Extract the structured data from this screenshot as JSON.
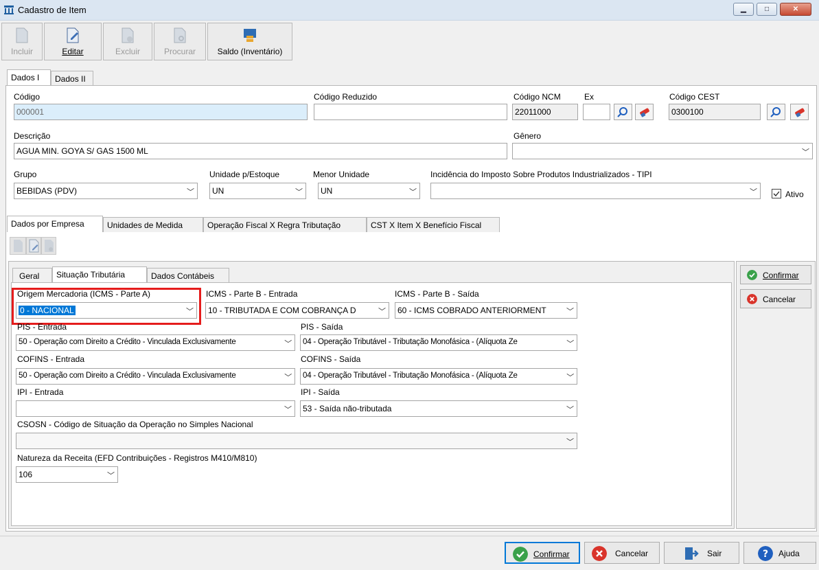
{
  "window": {
    "title": "Cadastro de Item"
  },
  "toolbar": {
    "incluir": "Incluir",
    "editar": "Editar",
    "excluir": "Excluir",
    "procurar": "Procurar",
    "saldo": "Saldo (Inventário)"
  },
  "top_tabs": [
    "Dados I",
    "Dados II"
  ],
  "dados1": {
    "codigo_label": "Código",
    "codigo_value": "000001",
    "codigo_reduzido_label": "Código Reduzido",
    "codigo_reduzido_value": "",
    "ncm_label": "Código NCM",
    "ncm_value": "22011000",
    "ex_label": "Ex",
    "ex_value": "",
    "cest_label": "Código CEST",
    "cest_value": "0300100",
    "descricao_label": "Descrição",
    "descricao_value": "AGUA MIN. GOYA S/ GAS 1500 ML",
    "genero_label": "Gênero",
    "genero_value": "",
    "grupo_label": "Grupo",
    "grupo_value": "BEBIDAS (PDV)",
    "unidade_label": "Unidade p/Estoque",
    "unidade_value": "UN",
    "menor_unidade_label": "Menor Unidade",
    "menor_unidade_value": "UN",
    "tipi_label": "Incidência do Imposto Sobre Produtos Industrializados - TIPI",
    "tipi_value": "",
    "ativo_label": "Ativo",
    "ativo_checked": true
  },
  "mid_tabs": [
    "Dados por Empresa",
    "Unidades de Medida",
    "Operação Fiscal X Regra Tributação",
    "CST X Item X Benefício Fiscal"
  ],
  "inner_tabs": [
    "Geral",
    "Situação Tributária",
    "Dados Contábeis"
  ],
  "tributaria": {
    "origem_label": "Origem Mercadoria (ICMS - Parte A)",
    "origem_value": "0 - NACIONAL",
    "icms_b_entrada_label": "ICMS - Parte B - Entrada",
    "icms_b_entrada_value": "10 - TRIBUTADA E COM COBRANÇA D",
    "icms_b_saida_label": "ICMS - Parte B - Saída",
    "icms_b_saida_value": "60 - ICMS COBRADO ANTERIORMENT",
    "pis_entrada_label": "PIS - Entrada",
    "pis_entrada_value": "50 - Operação com Direito a Crédito - Vinculada Exclusivamente",
    "pis_saida_label": "PIS - Saída",
    "pis_saida_value": "04 - Operação Tributável - Tributação Monofásica - (Alíquota Ze",
    "cofins_entrada_label": "COFINS - Entrada",
    "cofins_entrada_value": "50 - Operação com Direito a Crédito - Vinculada Exclusivamente",
    "cofins_saida_label": "COFINS - Saída",
    "cofins_saida_value": "04 - Operação Tributável - Tributação Monofásica - (Alíquota Ze",
    "ipi_entrada_label": "IPI - Entrada",
    "ipi_entrada_value": "",
    "ipi_saida_label": "IPI - Saída",
    "ipi_saida_value": "53 - Saída não-tributada",
    "csosn_label": "CSOSN - Código de Situação da Operação no Simples Nacional",
    "csosn_value": "",
    "natureza_label": "Natureza da Receita (EFD Contribuições - Registros M410/M810)",
    "natureza_value": "106"
  },
  "side_buttons": {
    "confirmar": "Confirmar",
    "cancelar": "Cancelar"
  },
  "bottom_buttons": {
    "confirmar": "Confirmar",
    "cancelar": "Cancelar",
    "sair": "Sair",
    "ajuda": "Ajuda"
  },
  "colors": {
    "highlight_border": "#e51c1c",
    "selection": "#0078d7",
    "confirm_green": "#3aa14a",
    "cancel_red": "#d9342b",
    "help_blue": "#1f5fbf"
  }
}
